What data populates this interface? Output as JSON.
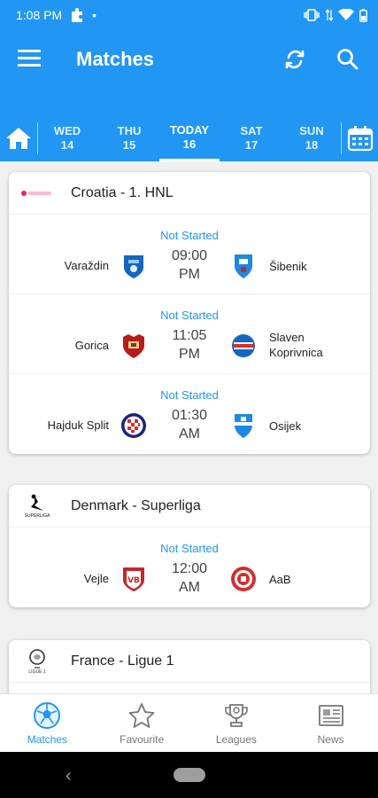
{
  "status_bar": {
    "time": "1:08 PM",
    "dot": "•"
  },
  "app_bar": {
    "title": "Matches"
  },
  "date_tabs": [
    {
      "day": "WED",
      "date": "14"
    },
    {
      "day": "THU",
      "date": "15"
    },
    {
      "day": "TODAY",
      "date": "16",
      "active": true
    },
    {
      "day": "SAT",
      "date": "17"
    },
    {
      "day": "SUN",
      "date": "18"
    }
  ],
  "leagues": [
    {
      "name": "Croatia - 1. HNL",
      "logo": "hnl-logo",
      "matches": [
        {
          "status": "Not Started",
          "time": "09:00",
          "ampm": "PM",
          "home": "Varaždin",
          "away": "Šibenik"
        },
        {
          "status": "Not Started",
          "time": "11:05",
          "ampm": "PM",
          "home": "Gorica",
          "away_line1": "Slaven",
          "away_line2": "Koprivnica"
        },
        {
          "status": "Not Started",
          "time": "01:30",
          "ampm": "AM",
          "home": "Hajduk Split",
          "away": "Osijek"
        }
      ]
    },
    {
      "name": "Denmark - Superliga",
      "logo": "superliga-logo",
      "logo_text": "SUPERLIGA",
      "matches": [
        {
          "status": "Not Started",
          "time": "12:00",
          "ampm": "AM",
          "home": "Vejle",
          "away": "AaB",
          "home_crest_text": "VB"
        }
      ]
    },
    {
      "name": "France - Ligue 1",
      "logo": "ligue1-logo",
      "logo_text": "LIGUE 1"
    }
  ],
  "bottom_nav": [
    {
      "label": "Matches",
      "icon": "soccer-ball-icon",
      "active": true
    },
    {
      "label": "Favourite",
      "icon": "star-icon"
    },
    {
      "label": "Leagues",
      "icon": "trophy-icon"
    },
    {
      "label": "News",
      "icon": "newspaper-icon"
    }
  ],
  "colors": {
    "primary": "#2196f3",
    "text": "#212121",
    "status": "#2196f3"
  }
}
